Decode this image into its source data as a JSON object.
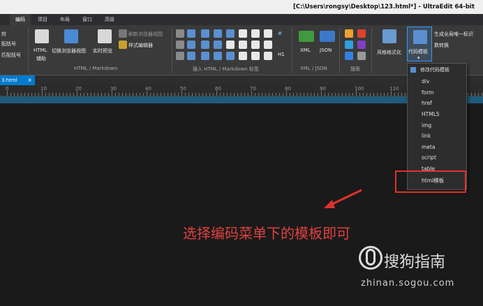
{
  "window": {
    "title": "[C:\\Users\\rongsy\\Desktop\\123.html*] - UltraEdit 64-bit"
  },
  "menu": {
    "tabs": [
      "编码",
      "项目",
      "布局",
      "窗口",
      "高级"
    ]
  },
  "ribbon": {
    "left_labels": [
      "符",
      "配括号",
      "匹配括号"
    ],
    "html_group": {
      "html_tag_label": "HTML",
      "html_tag_sub": "辅助",
      "switch_browser": "切换浏览器视图",
      "live_preview": "实时预览",
      "refresh_browser": "刷新浏览器视图",
      "style_editor": "样式编辑器",
      "group_label": "HTML / Markdown"
    },
    "insert_group": {
      "group_label": "插入 HTML / Markdown 标签",
      "hash": "#",
      "h1": "H1"
    },
    "xmljson_group": {
      "xml": "XML",
      "json": "JSON",
      "group_label": "XML / JSON"
    },
    "search_group": {
      "group_label": "搜索"
    },
    "code_group": {
      "style_format": "风格格式化",
      "code_template": "代码模板",
      "gen_unique": "生成全局唯一标识",
      "num_convert": "数转换"
    }
  },
  "file_tab": {
    "name": "3.html",
    "close": "×"
  },
  "ruler": {
    "numbers": [
      "0",
      "10",
      "20",
      "30",
      "40",
      "50",
      "60",
      "70",
      "80",
      "90",
      "100",
      "110",
      "12"
    ]
  },
  "dropdown": {
    "header": "修改代码模板",
    "items": [
      "div",
      "form",
      "href",
      "HTML5",
      "img",
      "link",
      "meta",
      "script",
      "table",
      "html模板"
    ]
  },
  "annotation": {
    "text": "选择编码菜单下的模板即可"
  },
  "watermark": {
    "brand": "搜狗指南",
    "url": "zhinan.sogou.com"
  },
  "colors": {
    "accent": "#007acc",
    "highlight": "#e03030"
  }
}
